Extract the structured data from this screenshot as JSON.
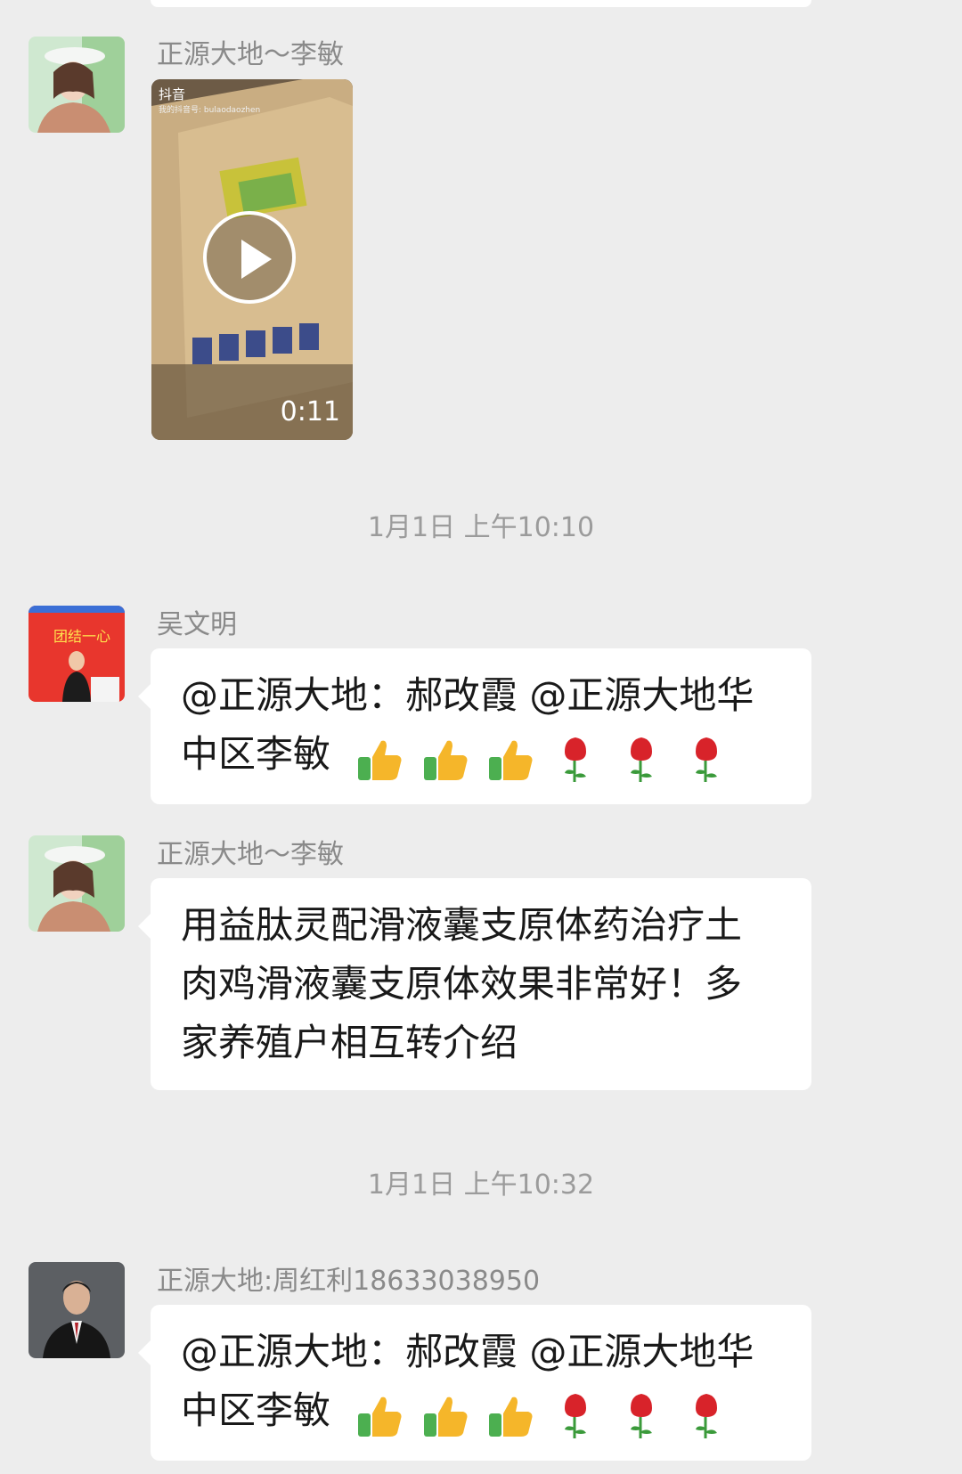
{
  "messages": [
    {
      "sender": "正源大地～李敏",
      "type": "video",
      "video": {
        "duration": "0:11",
        "app_name": "抖音",
        "account": "我的抖音号: bulaodaozhen"
      }
    },
    {
      "timestamp": "1月1日 上午10:10"
    },
    {
      "sender": "吴文明",
      "type": "text",
      "text_line1": "@正源大地：郝改霞 @正源大地华",
      "text_line2": "中区李敏",
      "emojis": [
        "thumbs-up",
        "thumbs-up",
        "thumbs-up",
        "rose",
        "rose",
        "rose"
      ]
    },
    {
      "sender": "正源大地～李敏",
      "type": "text",
      "text_line1": "用益肽灵配滑液囊支原体药治疗土",
      "text_line2": "肉鸡滑液囊支原体效果非常好！多",
      "text_line3": "家养殖户相互转介绍"
    },
    {
      "timestamp": "1月1日 上午10:32"
    },
    {
      "sender": "正源大地:周红利18633038950",
      "type": "text",
      "text_line1": "@正源大地：郝改霞 @正源大地华",
      "text_line2": "中区李敏",
      "emojis": [
        "thumbs-up",
        "thumbs-up",
        "thumbs-up",
        "rose",
        "rose",
        "rose"
      ]
    }
  ],
  "avatar_texts": {
    "wu_wenming": "团结一心"
  },
  "colors": {
    "background": "#ededed",
    "bubble": "#ffffff",
    "sender_name": "#8a8a8a",
    "timestamp": "#9b9b9b"
  }
}
